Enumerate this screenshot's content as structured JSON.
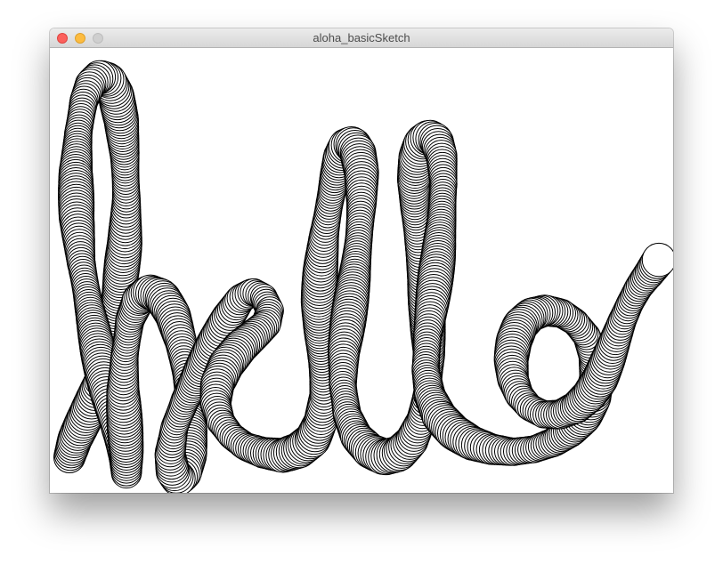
{
  "window": {
    "title": "aloha_basicSketch",
    "traffic_lights": {
      "close_color": "#fc605c",
      "minimize_color": "#fdbc40",
      "zoom_color": "#cfcfcf"
    }
  },
  "sketch": {
    "background_color": "#ffffff",
    "circle_fill": "#ffffff",
    "circle_stroke": "#000000",
    "drawn_word_shape": "hello"
  }
}
